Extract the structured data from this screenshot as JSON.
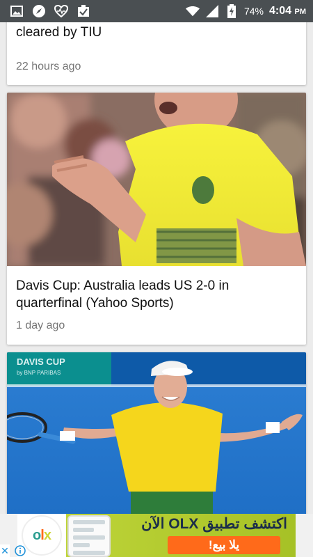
{
  "status_bar": {
    "battery_percent": "74%",
    "time": "4:04",
    "ampm": "PM",
    "icons": [
      "image-icon",
      "compass-icon",
      "health-icon",
      "task-icon",
      "wifi-icon",
      "signal-icon",
      "battery-charging-icon"
    ]
  },
  "feed": {
    "items": [
      {
        "headline": "Three suspicious matches at Australian Open cleared by TIU",
        "time_ago": "22 hours ago"
      },
      {
        "headline": "Davis Cup: Australia leads US 2-0 in quarterfinal (Yahoo Sports)",
        "time_ago": "1 day ago"
      },
      {
        "image_text": "DAVIS CUP",
        "image_subtext": "by BNP PARIBAS"
      }
    ]
  },
  "ad": {
    "logo": "OLX",
    "headline": "اكتشف تطبيق OLX الآن",
    "cta": "يلا بيع!",
    "close": "✕"
  },
  "colors": {
    "status_bar": "#4a4f52",
    "ad_green": "#b5cd2f",
    "ad_orange": "#ff6a1a",
    "card_shirt_yellow": "#f6ef3a"
  }
}
